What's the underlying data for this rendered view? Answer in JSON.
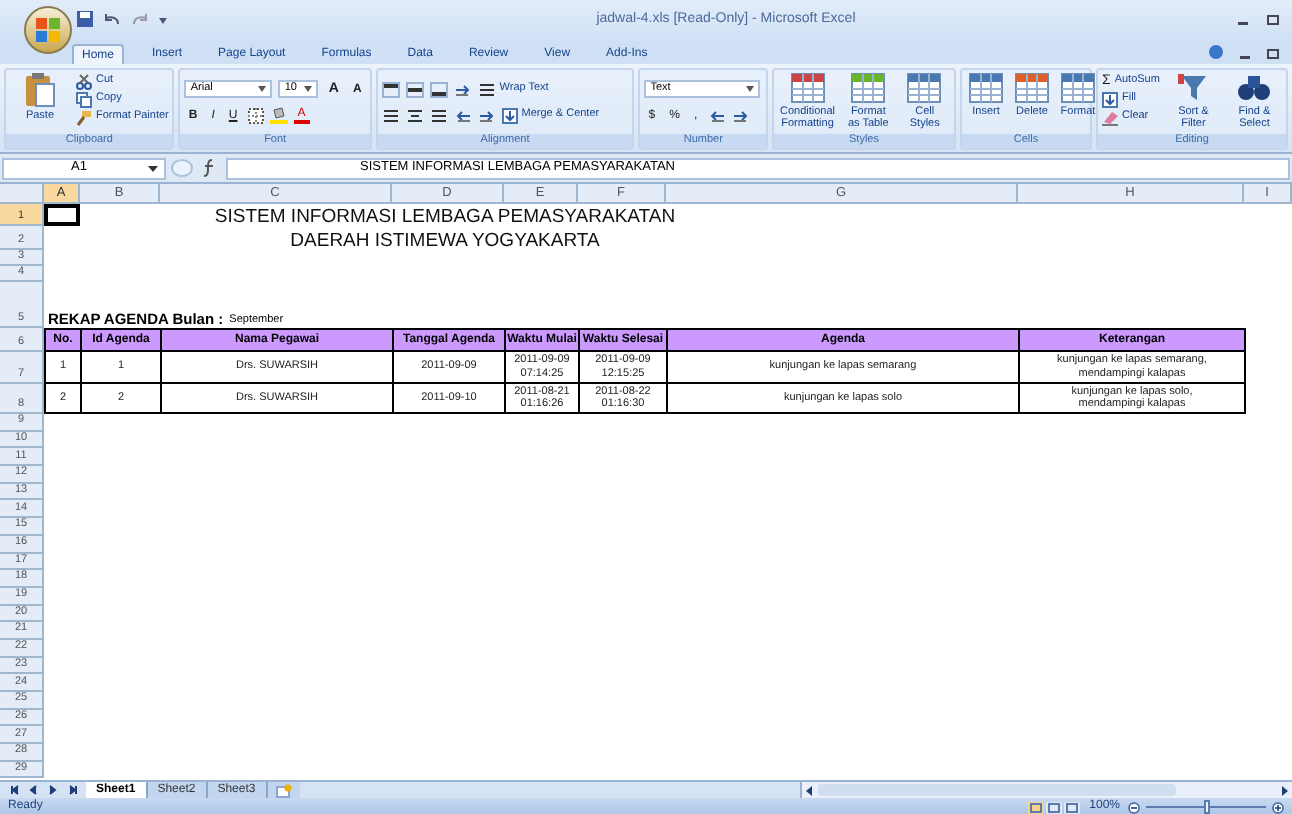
{
  "window": {
    "title": "jadwal-4.xls  [Read-Only] - Microsoft Excel"
  },
  "ribbon_tabs": [
    {
      "label": "Home",
      "selected": true
    },
    {
      "label": "Insert",
      "selected": false
    },
    {
      "label": "Page Layout",
      "selected": false
    },
    {
      "label": "Formulas",
      "selected": false
    },
    {
      "label": "Data",
      "selected": false
    },
    {
      "label": "Review",
      "selected": false
    },
    {
      "label": "View",
      "selected": false
    },
    {
      "label": "Add-Ins",
      "selected": false
    }
  ],
  "ribbon": {
    "groups": [
      {
        "label": "Clipboard",
        "items": [
          "Paste",
          "Cut",
          "Copy",
          "Format Painter"
        ]
      },
      {
        "label": "Font",
        "items": [
          "Arial",
          "10",
          "A",
          "A",
          "B",
          "I",
          "U",
          "A"
        ]
      },
      {
        "label": "Alignment",
        "items": [
          "Wrap Text",
          "Merge & Center"
        ]
      },
      {
        "label": "Number",
        "items": [
          "Text",
          "$",
          "%",
          ","
        ]
      },
      {
        "label": "Styles",
        "items": [
          "Conditional Formatting",
          "Format as Table",
          "Cell Styles"
        ]
      },
      {
        "label": "Cells",
        "items": [
          "Insert",
          "Delete",
          "Format"
        ]
      },
      {
        "label": "Editing",
        "items": [
          "Σ",
          "AutoSum",
          "Fill",
          "Clear",
          "Sort & Filter",
          "Find & Select"
        ]
      }
    ]
  },
  "formula_bar": {
    "name_box": "A1",
    "content": "SISTEM INFORMASI LEMBAGA PEMASYARAKATAN"
  },
  "sheet": {
    "column_headers": [
      {
        "label": "A",
        "selected": true
      },
      {
        "label": "B",
        "selected": false
      },
      {
        "label": "C",
        "selected": false
      },
      {
        "label": "D",
        "selected": false
      },
      {
        "label": "E",
        "selected": false
      },
      {
        "label": "F",
        "selected": false
      },
      {
        "label": "G",
        "selected": false
      },
      {
        "label": "H",
        "selected": false
      },
      {
        "label": "I",
        "selected": false
      }
    ],
    "row_headers": [
      {
        "label": "1",
        "selected": true
      },
      {
        "label": "2",
        "selected": false
      },
      {
        "label": "3",
        "selected": false
      },
      {
        "label": "4",
        "selected": false
      },
      {
        "label": "5",
        "selected": false
      },
      {
        "label": "6",
        "selected": false
      },
      {
        "label": "7",
        "selected": false
      },
      {
        "label": "8",
        "selected": false
      },
      {
        "label": "9",
        "selected": false
      },
      {
        "label": "10",
        "selected": false
      },
      {
        "label": "11",
        "selected": false
      },
      {
        "label": "12",
        "selected": false
      },
      {
        "label": "13",
        "selected": false
      },
      {
        "label": "14",
        "selected": false
      },
      {
        "label": "15",
        "selected": false
      },
      {
        "label": "16",
        "selected": false
      },
      {
        "label": "17",
        "selected": false
      },
      {
        "label": "18",
        "selected": false
      },
      {
        "label": "19",
        "selected": false
      },
      {
        "label": "20",
        "selected": false
      },
      {
        "label": "21",
        "selected": false
      },
      {
        "label": "22",
        "selected": false
      },
      {
        "label": "23",
        "selected": false
      },
      {
        "label": "24",
        "selected": false
      },
      {
        "label": "25",
        "selected": false
      },
      {
        "label": "26",
        "selected": false
      },
      {
        "label": "27",
        "selected": false
      },
      {
        "label": "28",
        "selected": false
      },
      {
        "label": "29",
        "selected": false
      }
    ],
    "title_lines": [
      "SISTEM INFORMASI LEMBAGA PEMASYARAKATAN",
      "DAERAH ISTIMEWA YOGYAKARTA"
    ],
    "recap_label": "REKAP AGENDA Bulan :",
    "recap_value": "September",
    "table": {
      "columns": [
        "No.",
        "Id Agenda",
        "Nama Pegawai",
        "Tanggal Agenda",
        "Waktu Mulai",
        "Waktu Selesai",
        "Agenda",
        "Keterangan"
      ],
      "rows": [
        [
          "1",
          "1",
          "Drs. SUWARSIH",
          "2011-09-09",
          "2011-09-09\n07:14:25",
          "2011-09-09\n12:15:25",
          "kunjungan ke lapas semarang",
          "kunjungan ke lapas semarang,\nmendampingi kalapas"
        ],
        [
          "2",
          "2",
          "Drs. SUWARSIH",
          "2011-09-10",
          "2011-08-21\n01:16:26",
          "2011-08-22\n01:16:30",
          "kunjungan ke lapas solo",
          "kunjungan ke lapas solo,\nmendampingi kalapas"
        ]
      ]
    }
  },
  "sheet_tabs": [
    {
      "label": "Sheet1",
      "selected": true
    },
    {
      "label": "Sheet2",
      "selected": false
    },
    {
      "label": "Sheet3",
      "selected": false
    }
  ],
  "status_bar": {
    "text": "Ready",
    "zoom": "100%",
    "zoom_slider": {
      "level": 0.5
    }
  }
}
